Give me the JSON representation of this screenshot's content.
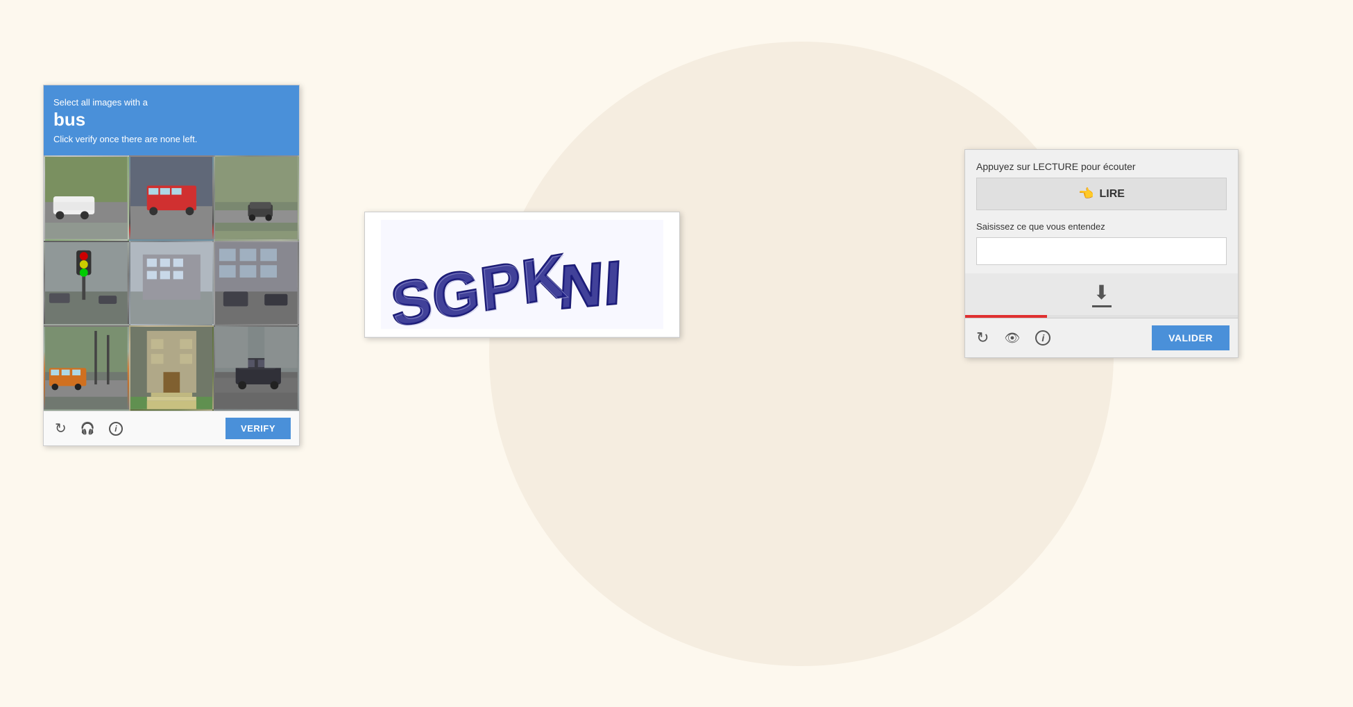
{
  "background": {
    "color": "#fdf8ee",
    "circle_color": "#f5ede0"
  },
  "captcha_image": {
    "header": {
      "line1": "Select all images with a",
      "keyword": "bus",
      "line2": "Click verify once there are none left."
    },
    "grid_cells": [
      {
        "id": 1,
        "alt": "street with white van"
      },
      {
        "id": 2,
        "alt": "bus at stop"
      },
      {
        "id": 3,
        "alt": "road with cars"
      },
      {
        "id": 4,
        "alt": "street with traffic light"
      },
      {
        "id": 5,
        "alt": "street intersection"
      },
      {
        "id": 6,
        "alt": "city buildings"
      },
      {
        "id": 7,
        "alt": "street with bus"
      },
      {
        "id": 8,
        "alt": "building entrance"
      },
      {
        "id": 9,
        "alt": "parking lot with SUV"
      }
    ],
    "footer": {
      "verify_label": "VERIFY",
      "refresh_icon": "refresh-icon",
      "headphone_icon": "headphone-icon",
      "info_icon": "info-icon"
    }
  },
  "captcha_text": {
    "image_text": "SGPKNI"
  },
  "captcha_audio": {
    "header_label": "Appuyez sur LECTURE pour écouter",
    "lire_label": "LIRE",
    "saisir_label": "Saisissez ce que vous entendez",
    "input_placeholder": "",
    "valider_label": "VALIDER",
    "refresh_icon": "refresh-icon",
    "eye_icon": "eye-icon",
    "info_icon": "info-icon",
    "download_icon": "download-icon"
  }
}
